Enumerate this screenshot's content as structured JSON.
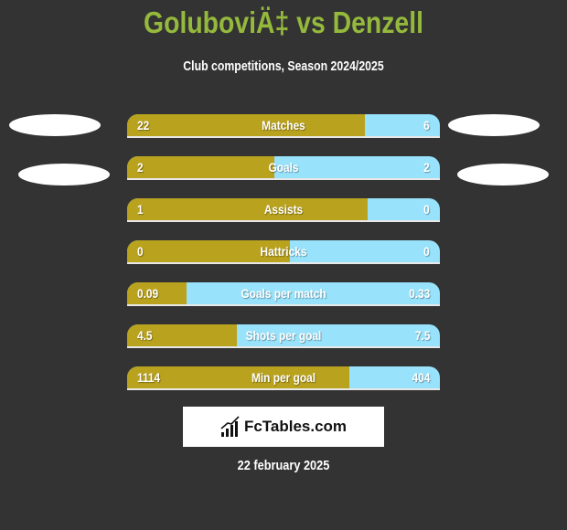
{
  "header": {
    "title": "GoluboviÄ‡ vs Denzell",
    "subtitle": "Club competitions, Season 2024/2025"
  },
  "colors": {
    "background": "#333333",
    "title": "#94b93c",
    "left_player": "#b9a21e",
    "right_player": "#98e2fb"
  },
  "stats": [
    {
      "label": "Matches",
      "left": "22",
      "right": "6",
      "left_share": 0.76
    },
    {
      "label": "Goals",
      "left": "2",
      "right": "2",
      "left_share": 0.47
    },
    {
      "label": "Assists",
      "left": "1",
      "right": "0",
      "left_share": 0.77
    },
    {
      "label": "Hattricks",
      "left": "0",
      "right": "0",
      "left_share": 0.52
    },
    {
      "label": "Goals per match",
      "left": "0.09",
      "right": "0.33",
      "left_share": 0.19
    },
    {
      "label": "Shots per goal",
      "left": "4.5",
      "right": "7.5",
      "left_share": 0.35
    },
    {
      "label": "Min per goal",
      "left": "1114",
      "right": "404",
      "left_share": 0.71
    }
  ],
  "logo": {
    "icon": "bar-chart-trend-icon",
    "text": "FcTables.com"
  },
  "date": "22 february 2025"
}
